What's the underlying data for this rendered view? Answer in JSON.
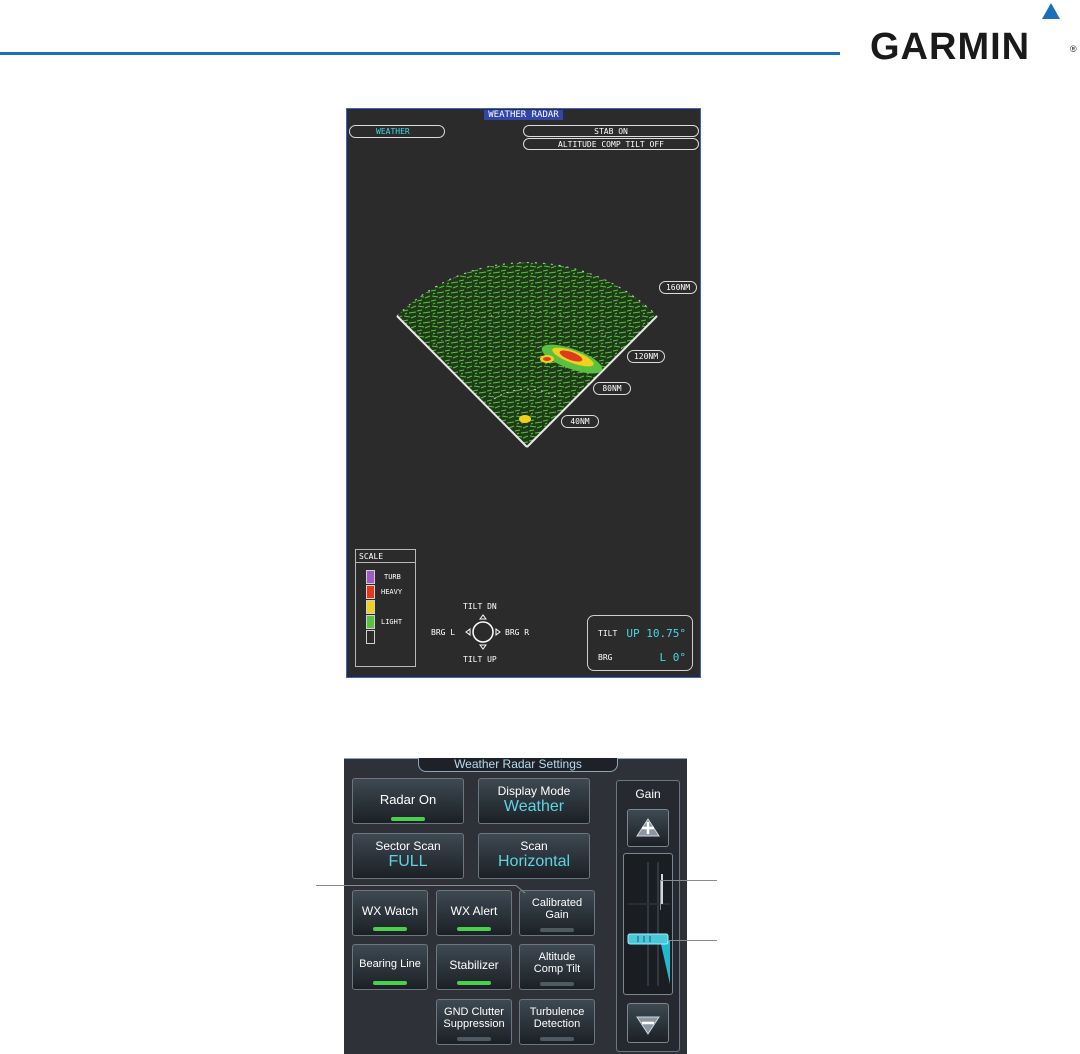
{
  "brand": {
    "name": "GARMIN",
    "registered": "®"
  },
  "radar": {
    "title": "WEATHER RADAR",
    "mode": "WEATHER",
    "stab": "STAB ON",
    "altitude_comp": "ALTITUDE COMP TILT OFF",
    "ranges": [
      "160NM",
      "120NM",
      "80NM",
      "40NM"
    ],
    "scale": {
      "title": "SCALE",
      "items": [
        {
          "label": "TURB",
          "color": "#a05ac8"
        },
        {
          "label": "HEAVY",
          "color": "#e03a1e"
        },
        {
          "label": "",
          "color": "#f0d21e"
        },
        {
          "label": "LIGHT",
          "color": "#5ac040"
        },
        {
          "label": "",
          "color": "#2b2b2b"
        }
      ]
    },
    "tilt_control": {
      "up_label": "TILT DN",
      "down_label": "TILT UP",
      "left_label": "BRG L",
      "right_label": "BRG R"
    },
    "tilt_readout": {
      "tilt_label": "TILT",
      "tilt_value": "UP 10.75°",
      "brg_label": "BRG",
      "brg_value": "L 0°"
    },
    "colors": {
      "return_light": "#5ac040",
      "return_heavy": "#e03a1e",
      "return_moderate": "#f0d21e",
      "return_turb": "#a05ac8",
      "accent": "#46d6e6"
    }
  },
  "settings": {
    "title": "Weather Radar Settings",
    "radar_on": {
      "label": "Radar On",
      "state": "on"
    },
    "display_mode": {
      "label": "Display Mode",
      "value": "Weather"
    },
    "sector_scan": {
      "label": "Sector Scan",
      "value": "FULL"
    },
    "scan": {
      "label": "Scan",
      "value": "Horizontal"
    },
    "wx_watch": {
      "label": "WX Watch",
      "state": "on"
    },
    "wx_alert": {
      "label": "WX Alert",
      "state": "on"
    },
    "calibrated_gain": {
      "line1": "Calibrated",
      "line2": "Gain",
      "state": "off"
    },
    "bearing_line": {
      "label": "Bearing Line",
      "state": "on"
    },
    "stabilizer": {
      "label": "Stabilizer",
      "state": "on"
    },
    "altitude_comp_tilt": {
      "line1": "Altitude",
      "line2": "Comp Tilt",
      "state": "off"
    },
    "gnd_clutter": {
      "line1": "GND Clutter",
      "line2": "Suppression",
      "state": "off"
    },
    "turbulence": {
      "line1": "Turbulence",
      "line2": "Detection",
      "state": "off"
    },
    "gain": {
      "label": "Gain"
    }
  }
}
